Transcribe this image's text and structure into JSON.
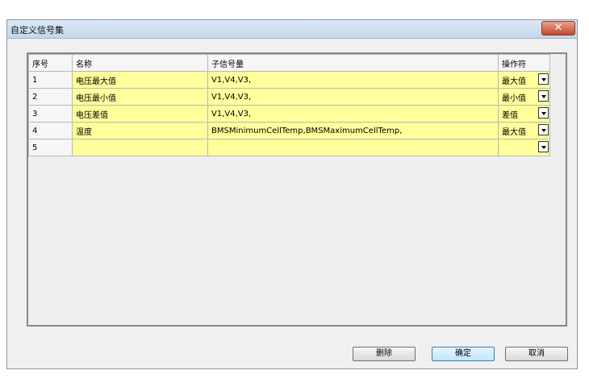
{
  "window": {
    "title": "自定义信号集",
    "close_glyph": "✕"
  },
  "table": {
    "headers": [
      "序号",
      "名称",
      "子信号量",
      "操作符"
    ],
    "rows": [
      {
        "index": "1",
        "name": "电压最大值",
        "signals": "V1,V4,V3,",
        "operator": "最大值"
      },
      {
        "index": "2",
        "name": "电压最小值",
        "signals": "V1,V4,V3,",
        "operator": "最小值"
      },
      {
        "index": "3",
        "name": "电压差值",
        "signals": "V1,V4,V3,",
        "operator": "差值"
      },
      {
        "index": "4",
        "name": "温度",
        "signals": "BMSMinimumCellTemp,BMSMaximumCellTemp,",
        "operator": "最大值"
      },
      {
        "index": "5",
        "name": "",
        "signals": "",
        "operator": ""
      }
    ]
  },
  "buttons": {
    "delete": "删除",
    "ok": "确定",
    "cancel": "取消"
  },
  "colors": {
    "editable_cell": "#ffff9c",
    "titlebar": "#c4d7ec"
  }
}
